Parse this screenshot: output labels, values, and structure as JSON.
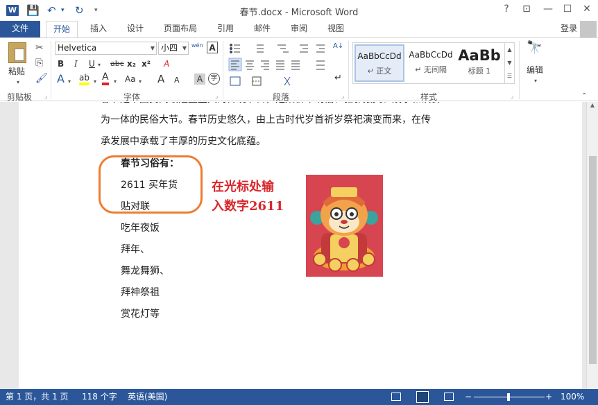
{
  "window": {
    "title": "春节.docx - Microsoft Word",
    "help": "?",
    "controls": {
      "ribbon_display": "⊡",
      "minimize": "—",
      "maximize": "☐",
      "close": "✕"
    }
  },
  "qat": {
    "save": "💾",
    "undo": "↶",
    "undo_drop": "▾",
    "redo": "↻",
    "customize": "▾"
  },
  "tabs": [
    {
      "label": "文件"
    },
    {
      "label": "开始"
    },
    {
      "label": "插入"
    },
    {
      "label": "设计"
    },
    {
      "label": "页面布局"
    },
    {
      "label": "引用"
    },
    {
      "label": "邮件"
    },
    {
      "label": "审阅"
    },
    {
      "label": "视图"
    }
  ],
  "account": {
    "login": "登录"
  },
  "ribbon": {
    "clipboard": {
      "group_label": "剪贴板",
      "paste_label": "粘贴",
      "cut": "✂",
      "copy": "⎘",
      "format_painter": "🖌"
    },
    "font": {
      "group_label": "字体",
      "font_name": "Helvetica",
      "font_size": "小四",
      "wen": "wén",
      "A_box": "A",
      "bold": "B",
      "italic": "I",
      "underline": "U",
      "strike": "abc",
      "subscript": "x₂",
      "superscript": "x²",
      "clear_format": "A",
      "text_effect": "A",
      "highlight": "ab",
      "font_color": "A",
      "change_case": "Aa",
      "grow": "A",
      "shrink": "A",
      "char_shade": "A",
      "enclose": "字"
    },
    "paragraph": {
      "group_label": "段落",
      "sort": "A↓",
      "show_marks": "↵"
    },
    "styles": {
      "group_label": "样式",
      "items": [
        {
          "sample": "AaBbCcDd",
          "name": "↵ 正文"
        },
        {
          "sample": "AaBbCcDd",
          "name": "↵ 无间隔"
        },
        {
          "sample": "AaBb",
          "name": "标题 1"
        }
      ]
    },
    "editing": {
      "label": "编辑",
      "icon": "🔭"
    }
  },
  "document": {
    "lines": [
      "为一体的民俗大节。春节历史悠久，由上古时代岁首祈岁祭祀演变而来，在传",
      "承发展中承载了丰厚的历史文化底蕴。"
    ],
    "customs_title": "春节习俗有：",
    "customs": [
      "2611  买年货",
      "贴对联",
      "吃年夜饭",
      "拜年、",
      "舞龙舞狮、",
      "拜神祭祖",
      "赏花灯等"
    ],
    "annotation": [
      "在光标处输",
      "入数字2611"
    ]
  },
  "status": {
    "page": "第 1 页，共 1 页",
    "words": "118 个字",
    "language": "英语(美国)",
    "zoom": "100%",
    "zoom_minus": "−",
    "zoom_plus": "+"
  }
}
